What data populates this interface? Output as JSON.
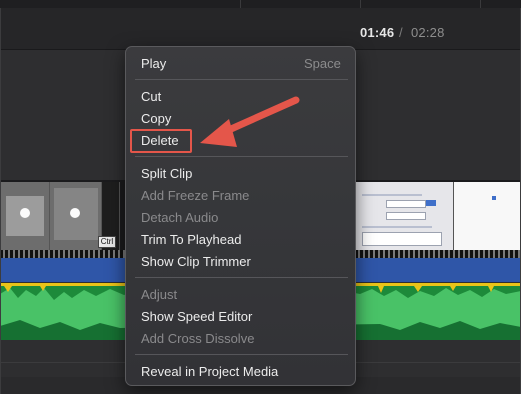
{
  "player": {
    "current_time": "01:46",
    "separator": "/",
    "total_time": "02:28"
  },
  "context_menu": {
    "play": {
      "label": "Play",
      "shortcut": "Space"
    },
    "cut": "Cut",
    "copy": "Copy",
    "delete": "Delete",
    "split_clip": "Split Clip",
    "add_freeze_frame": "Add Freeze Frame",
    "detach_audio": "Detach Audio",
    "trim_to_playhead": "Trim To Playhead",
    "show_clip_trimmer": "Show Clip Trimmer",
    "adjust": "Adjust",
    "show_speed_editor": "Show Speed Editor",
    "add_cross_dissolve": "Add Cross Dissolve",
    "reveal_in_project_media": "Reveal in Project Media"
  },
  "timeline": {
    "thumbnail_tag": "Ctrl"
  },
  "colors": {
    "annotation": "#e4564a",
    "audio_track": "#2f56a8",
    "waveform": "#1d8a3a",
    "waveform_peak": "#e9c318"
  }
}
